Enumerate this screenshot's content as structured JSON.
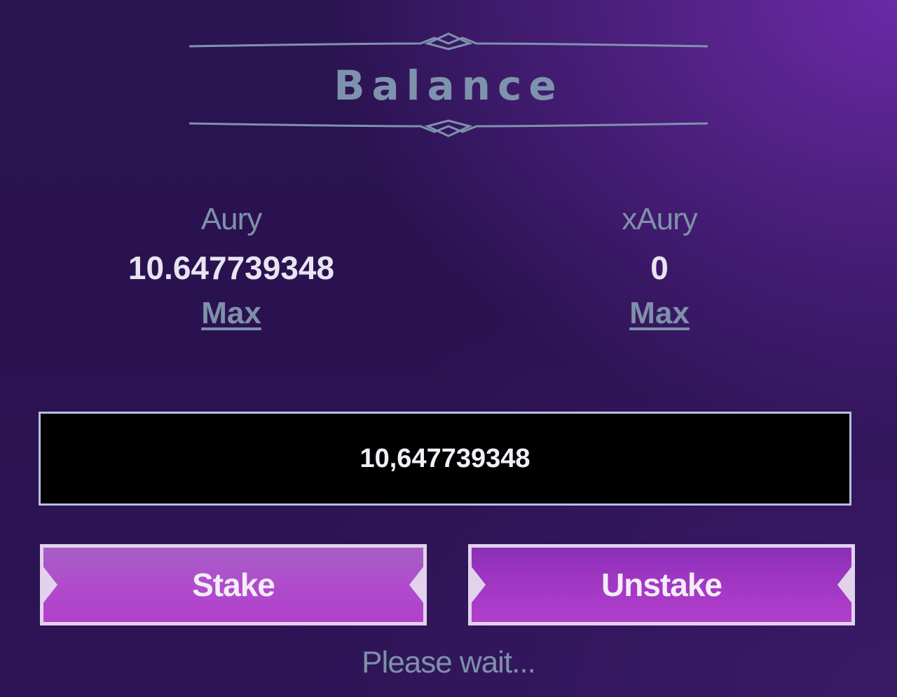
{
  "panel": {
    "title": "Balance"
  },
  "balances": [
    {
      "token": "Aury",
      "amount": "10.647739348",
      "max_label": "Max"
    },
    {
      "token": "xAury",
      "amount": "0",
      "max_label": "Max"
    }
  ],
  "amount_input": {
    "value": "10,647739348"
  },
  "actions": {
    "stake_label": "Stake",
    "unstake_label": "Unstake"
  },
  "status": "Please wait...",
  "colors": {
    "title": "#7d93ad",
    "accent_button": "#b13fcc",
    "button_border": "#e2d2ec",
    "input_background": "#000000",
    "input_border": "#b8bfe0"
  }
}
